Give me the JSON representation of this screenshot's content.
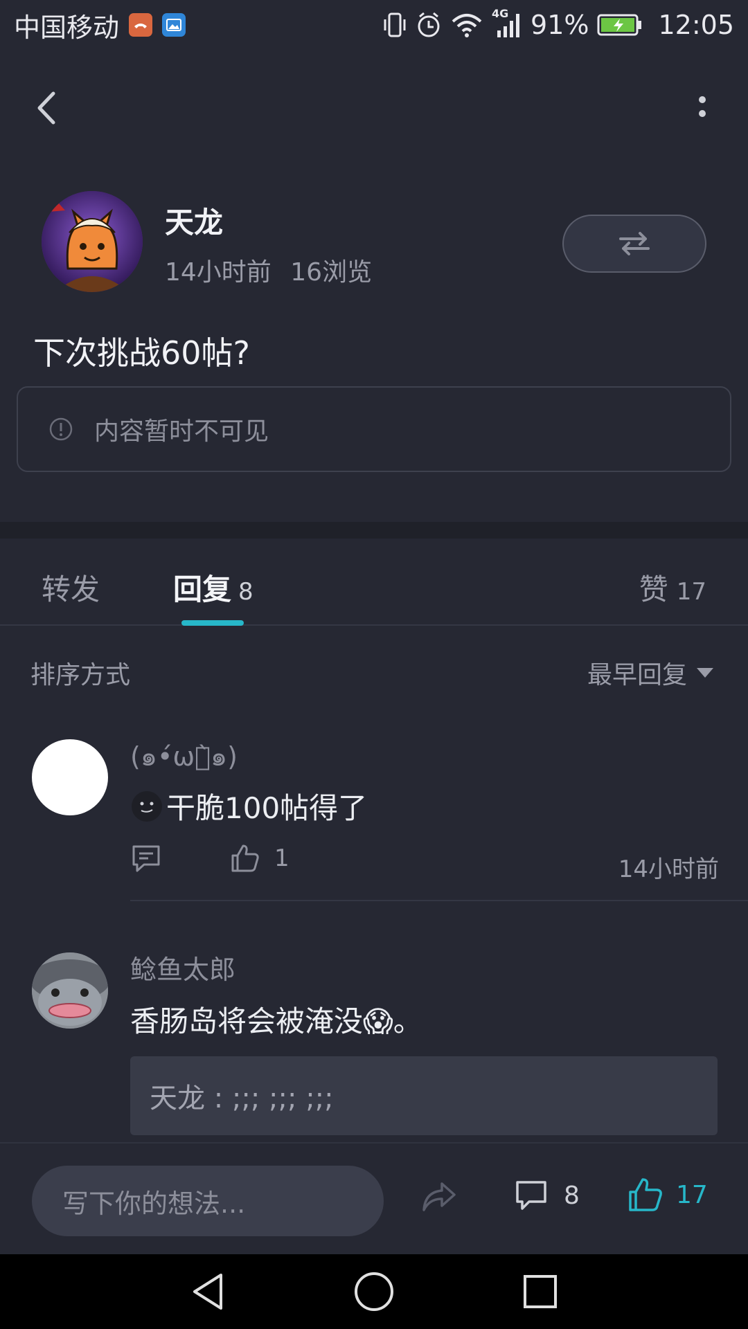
{
  "status": {
    "carrier": "中国移动",
    "network": "4G",
    "battery": "91%",
    "time": "12:05"
  },
  "post": {
    "author": "天龙",
    "time_ago": "14小时前",
    "views": "16浏览",
    "title": "下次挑战60帖?",
    "hidden_notice": "内容暂时不可见"
  },
  "tabs": {
    "forward": "转发",
    "reply": "回复",
    "reply_count": "8",
    "like": "赞",
    "like_count": "17"
  },
  "sort": {
    "label": "排序方式",
    "selected": "最早回复"
  },
  "comments": [
    {
      "name": "(๑•́ωก̀๑)",
      "text": "干脆100帖得了",
      "likes": "1",
      "time": "14小时前"
    },
    {
      "name": "鲶鱼太郎",
      "text": "香肠岛将会被淹没😱。",
      "quote": "天龙 : ;;; ;;; ;;;"
    }
  ],
  "bottom": {
    "input_placeholder": "写下你的想法...",
    "comment_count": "8",
    "like_count": "17"
  },
  "colors": {
    "background": "#262833",
    "accent": "#27b7c9",
    "muted_text": "#9a9ca8"
  }
}
